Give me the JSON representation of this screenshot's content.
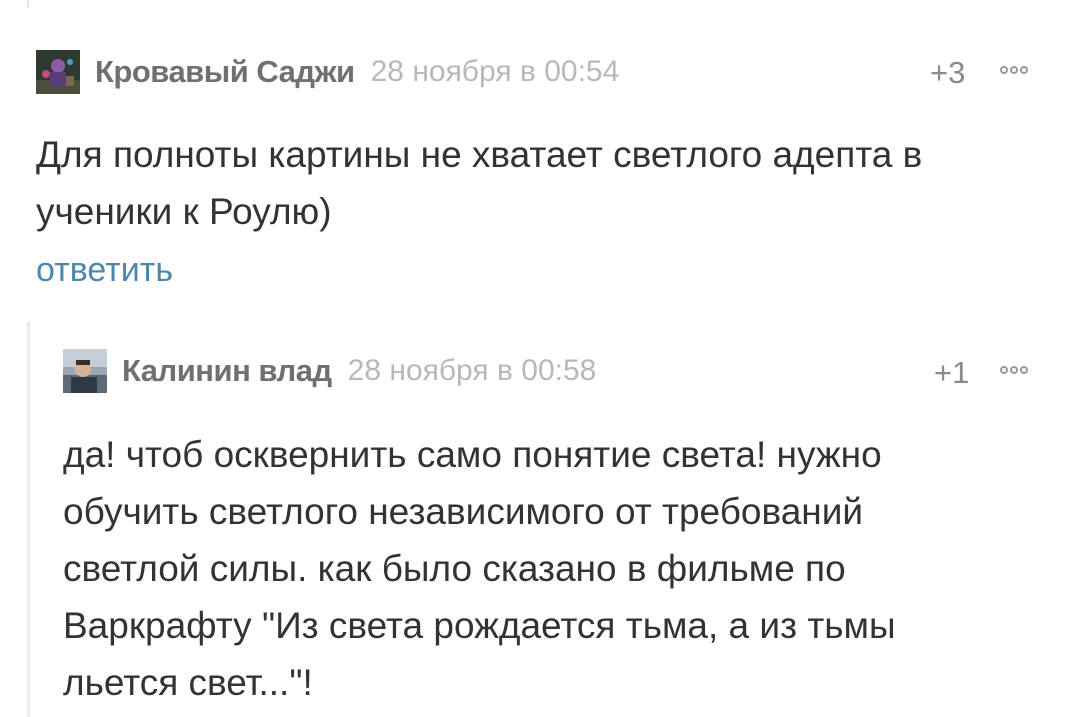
{
  "comments": [
    {
      "author": "Кровавый Саджи",
      "date": "28 ноября в 00:54",
      "rating": "+3",
      "text_lines": [
        "Для полноты картины не хватает светлого адепта в",
        "ученики к Роулю)"
      ],
      "reply_label": "ответить",
      "avatar_icon": "game-character-avatar"
    },
    {
      "author": "Калинин влад",
      "date": "28 ноября в 00:58",
      "rating": "+1",
      "text_lines": [
        "да! чтоб осквернить само понятие света! нужно",
        "обучить светлого независимого от требований",
        "светлой силы. как было сказано в фильме по",
        "Варкрафту \"Из света рождается тьма, а из тьмы",
        "льется свет...\"!"
      ],
      "avatar_icon": "person-photo-avatar"
    }
  ],
  "colors": {
    "author": "#707070",
    "date": "#b8b8b8",
    "text": "#333333",
    "link": "#4e87ab",
    "thread_line": "#ececec"
  },
  "icons": {
    "more": "more-options-icon"
  }
}
